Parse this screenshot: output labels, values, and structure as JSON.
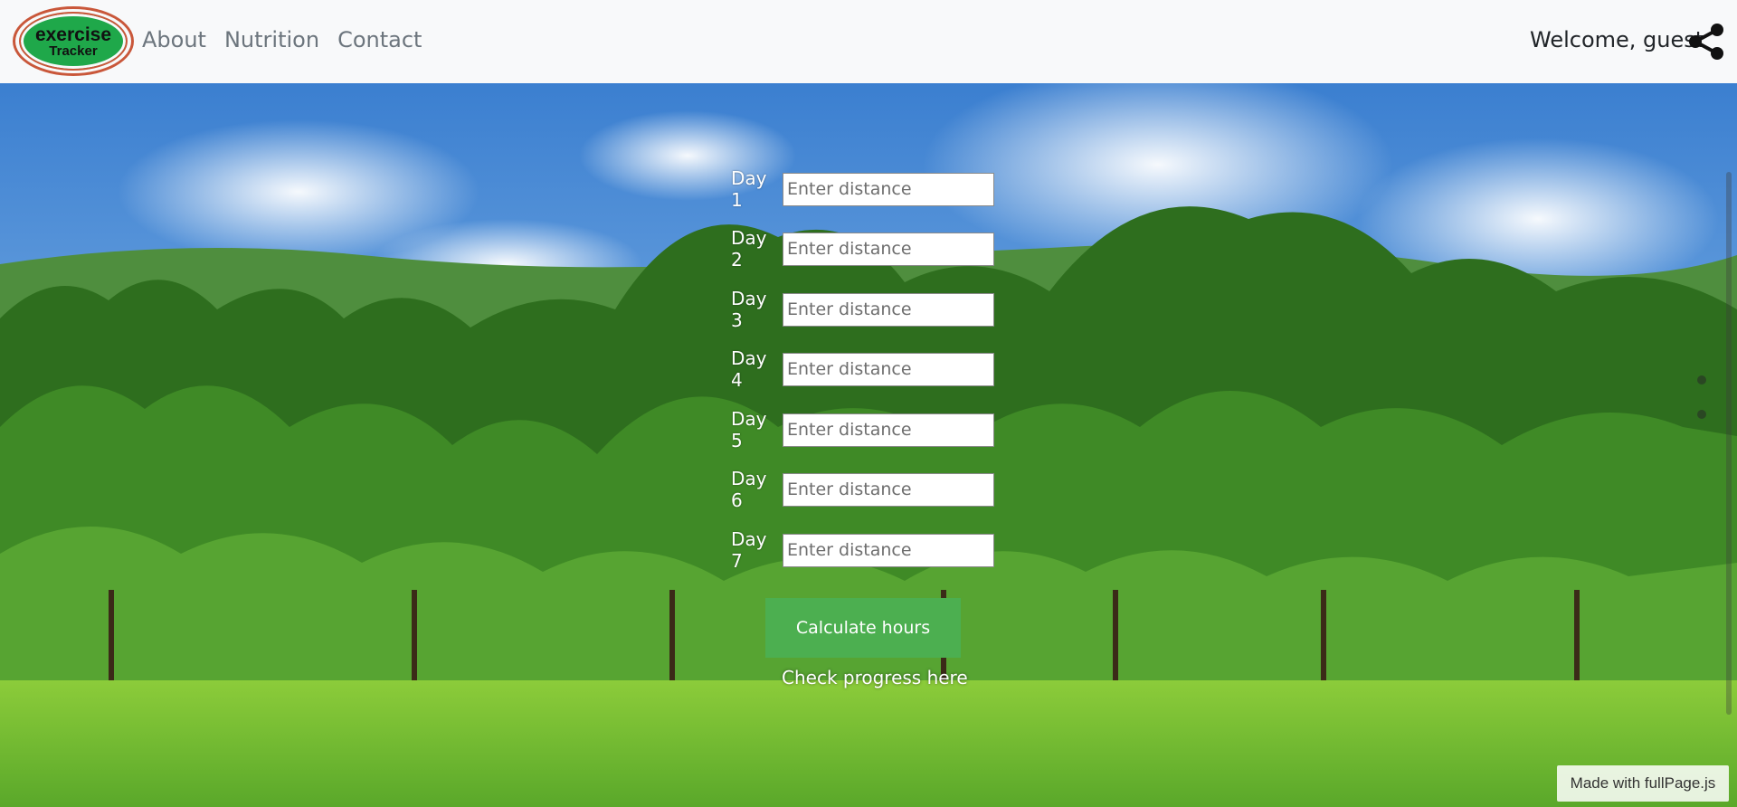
{
  "navbar": {
    "logo_line1": "exercise",
    "logo_line2": "Tracker",
    "links": [
      "About",
      "Nutrition",
      "Contact"
    ],
    "welcome": "Welcome, guest",
    "share_icon": "share-icon"
  },
  "form": {
    "days": [
      {
        "label": "Day 1",
        "placeholder": "Enter distance"
      },
      {
        "label": "Day 2",
        "placeholder": "Enter distance"
      },
      {
        "label": "Day 3",
        "placeholder": "Enter distance"
      },
      {
        "label": "Day 4",
        "placeholder": "Enter distance"
      },
      {
        "label": "Day 5",
        "placeholder": "Enter distance"
      },
      {
        "label": "Day 6",
        "placeholder": "Enter distance"
      },
      {
        "label": "Day 7",
        "placeholder": "Enter distance"
      }
    ],
    "calculate_label": "Calculate hours",
    "progress_link": "Check progress here"
  },
  "footer_badge": "Made with fullPage.js",
  "colors": {
    "navbar_bg": "#f8f9fa",
    "button_green": "#4caf50",
    "logo_green": "#1fa84a",
    "logo_ring": "#c9573a"
  }
}
